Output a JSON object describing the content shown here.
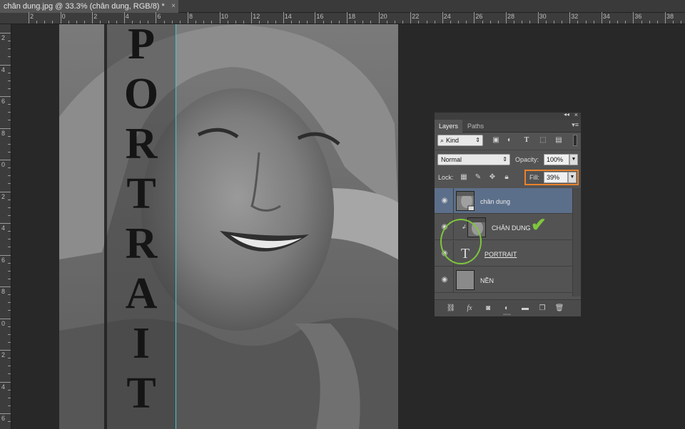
{
  "document_tab": {
    "title": "chân dung.jpg @ 33.3% (chân dung, RGB/8) *",
    "close_glyph": "×"
  },
  "ruler_top": {
    "labels": [
      "2",
      "0",
      "2",
      "4",
      "6",
      "8",
      "10",
      "12",
      "14",
      "16",
      "18",
      "20",
      "22",
      "24",
      "26",
      "28",
      "30",
      "32",
      "34",
      "36",
      "38"
    ]
  },
  "ruler_left": {
    "labels": [
      "2",
      "4",
      "6",
      "8",
      "0",
      "2",
      "4",
      "6",
      "8",
      "0",
      "2",
      "4",
      "6"
    ]
  },
  "canvas": {
    "artwork_text": "PORTRAIT"
  },
  "layers_panel": {
    "collapse_glyph": "◂◂",
    "close_glyph": "×",
    "tabs": [
      {
        "label": "Layers",
        "active": true
      },
      {
        "label": "Paths",
        "active": false
      }
    ],
    "menu_glyph": "▾≡",
    "filter": {
      "kind_label": "Kind",
      "icons": [
        "image-filter-icon",
        "adjustment-filter-icon",
        "type-filter-icon",
        "shape-filter-icon",
        "smart-object-filter-icon"
      ]
    },
    "blend_mode": "Normal",
    "opacity_label": "Opacity:",
    "opacity_value": "100%",
    "lock_label": "Lock:",
    "fill_label": "Fill:",
    "fill_value": "39%",
    "layers": [
      {
        "name": "chân dung",
        "selected": true
      },
      {
        "name": "CHÂN DUNG",
        "selected": false,
        "clipped": true
      },
      {
        "name": "PORTRAIT",
        "selected": false,
        "type_layer": true
      },
      {
        "name": "NỀN",
        "selected": false
      }
    ],
    "footer_icons": [
      "link-icon",
      "fx-icon",
      "mask-icon",
      "adjustment-icon",
      "folder-icon",
      "new-layer-icon",
      "trash-icon"
    ]
  },
  "annotations": {
    "check_glyph": "✔"
  },
  "colors": {
    "guide": "#3ec9cf",
    "fill_highlight": "#e8822e",
    "annotation_green": "#7fc63d",
    "selected_layer": "#5c6f8a"
  }
}
